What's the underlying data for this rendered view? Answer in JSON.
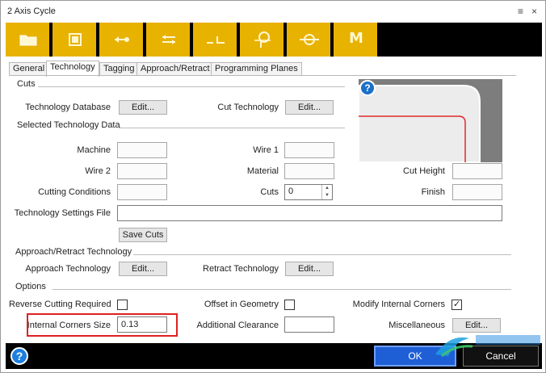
{
  "window": {
    "title": "2 Axis Cycle"
  },
  "toolbar": {
    "buttons": [
      {
        "icon": "folder-icon"
      },
      {
        "icon": "square-frame-icon"
      },
      {
        "icon": "arrow-left-icon"
      },
      {
        "icon": "arrows-swap-icon"
      },
      {
        "icon": "corner-path-icon"
      },
      {
        "icon": "p-curve-icon"
      },
      {
        "icon": "circle-line-icon"
      },
      {
        "icon": "m-letter-icon",
        "text": "M"
      }
    ]
  },
  "tabs": [
    "General",
    "Technology",
    "Tagging",
    "Approach/Retract",
    "Programming Planes"
  ],
  "active_tab": "Technology",
  "cuts": {
    "title": "Cuts",
    "tech_db_label": "Technology Database",
    "tech_db_button": "Edit...",
    "cut_tech_label": "Cut Technology",
    "cut_tech_button": "Edit..."
  },
  "selected": {
    "title": "Selected Technology Data",
    "machine_label": "Machine",
    "wire1_label": "Wire 1",
    "wire2_label": "Wire 2",
    "material_label": "Material",
    "cut_height_label": "Cut Height",
    "cutting_conditions_label": "Cutting Conditions",
    "cuts_label": "Cuts",
    "cuts_value": "0",
    "finish_label": "Finish",
    "settings_file_label": "Technology Settings File",
    "save_cuts_button": "Save Cuts"
  },
  "approach": {
    "title": "Approach/Retract Technology",
    "approach_label": "Approach Technology",
    "approach_button": "Edit...",
    "retract_label": "Retract Technology",
    "retract_button": "Edit..."
  },
  "options": {
    "title": "Options",
    "reverse_label": "Reverse Cutting Required",
    "offset_label": "Offset in Geometry",
    "modify_label": "Modify Internal Corners",
    "modify_checked": true,
    "internal_corners_label": "Internal Corners Size",
    "internal_corners_value": "0.13",
    "additional_clearance_label": "Additional Clearance",
    "misc_label": "Miscellaneous",
    "misc_button": "Edit..."
  },
  "bottom": {
    "ok": "OK",
    "cancel": "Cancel"
  },
  "colors": {
    "toolbar_gold": "#e8b200",
    "highlight_red": "#e02020",
    "ok_blue": "#1f5fd6"
  }
}
